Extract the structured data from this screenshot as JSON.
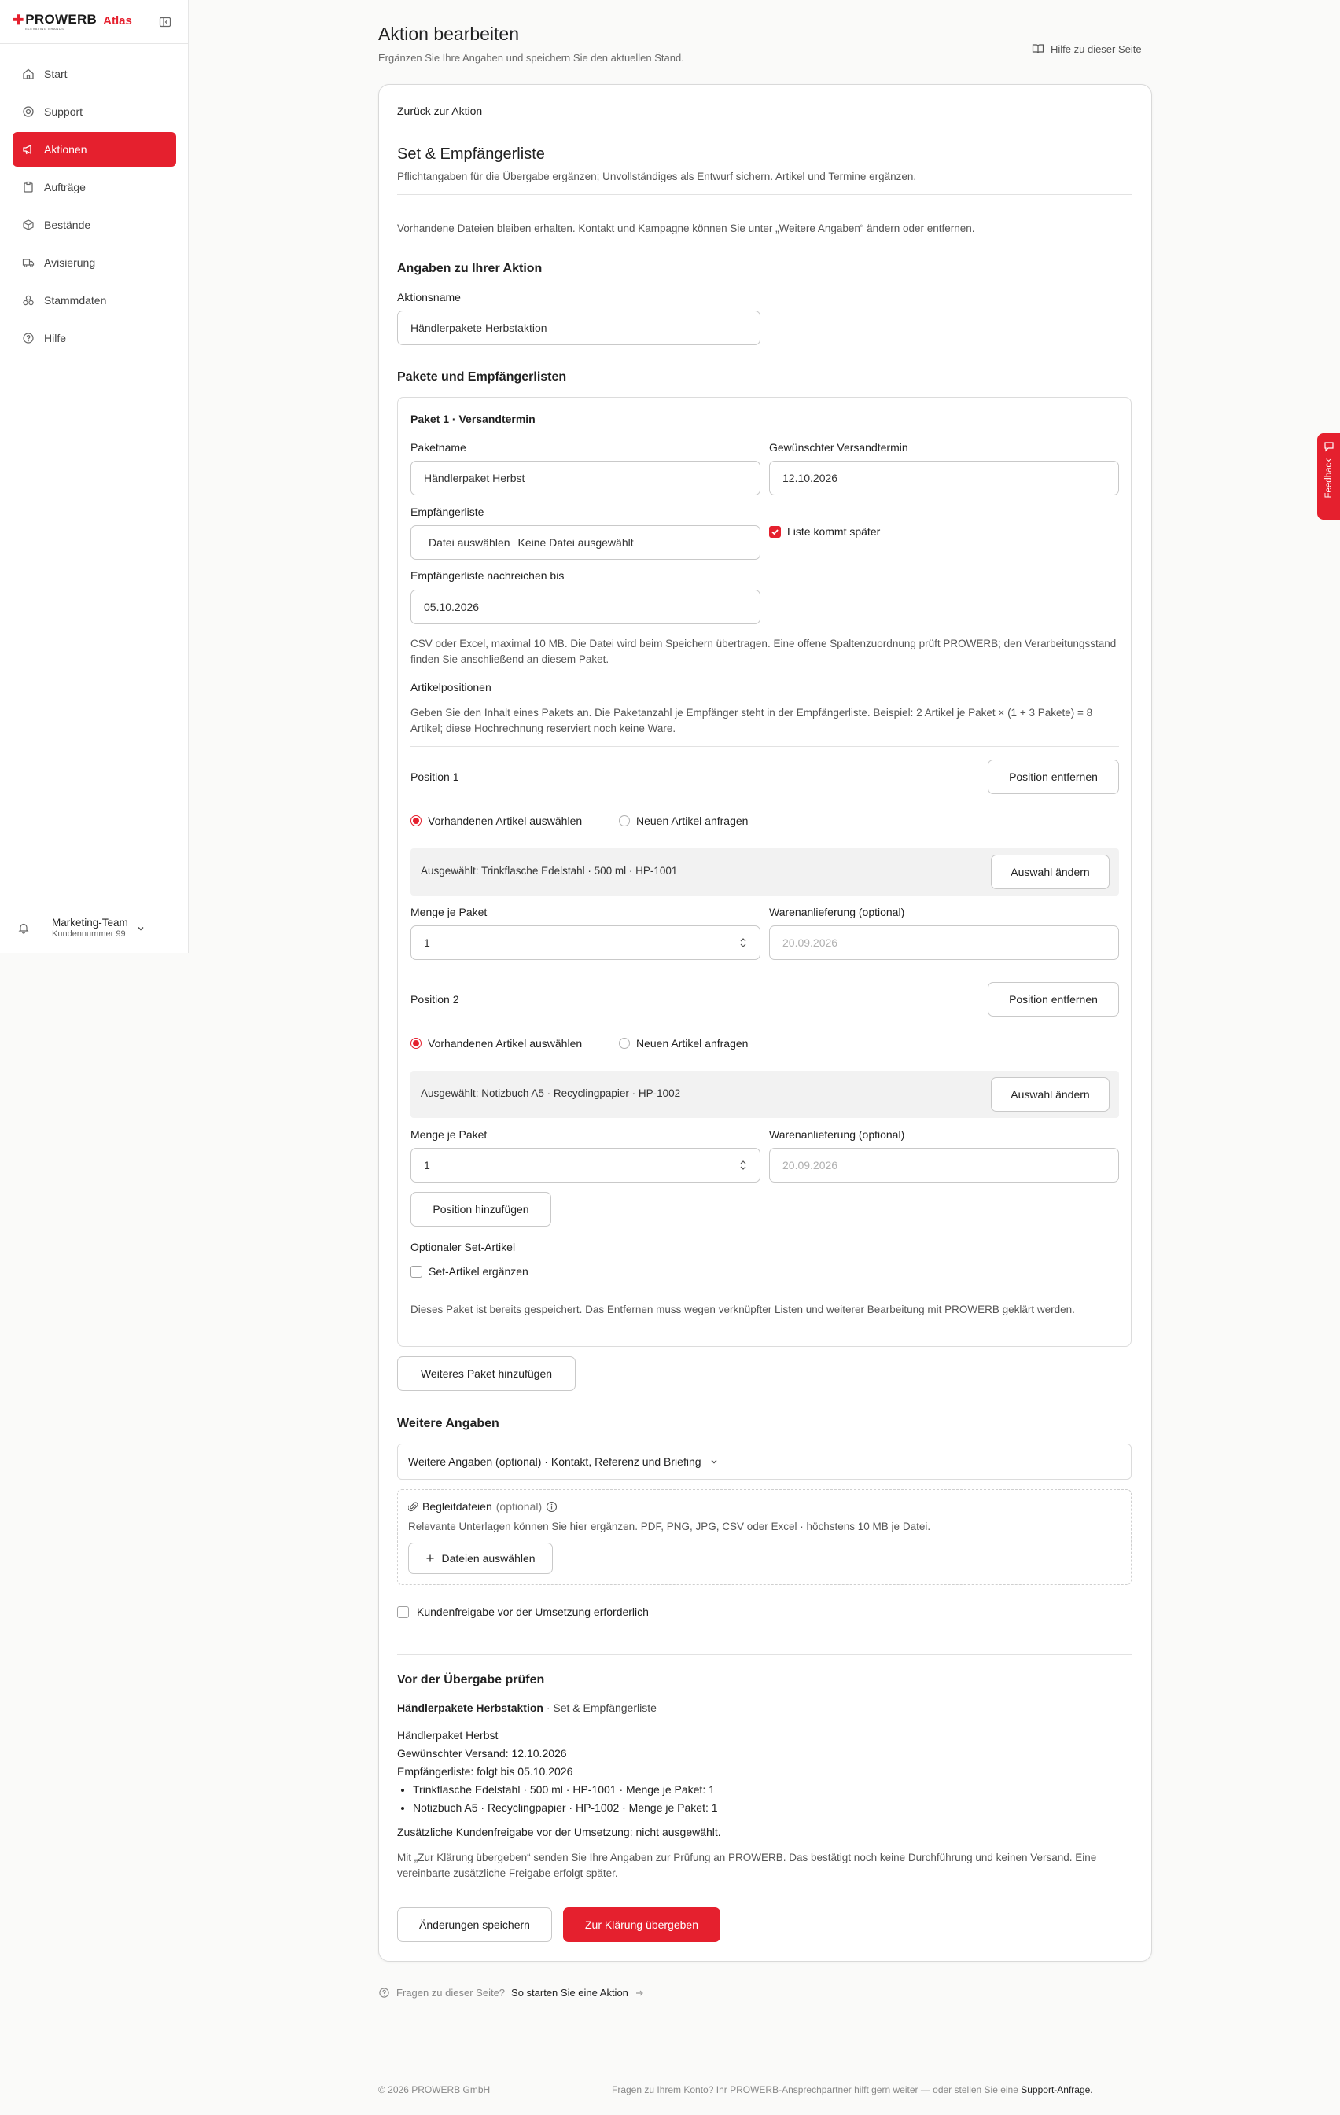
{
  "brand": {
    "logo": "PROWERB",
    "tagline": "ELEVATING BRANDS",
    "product": "Atlas"
  },
  "sidebar": {
    "items": [
      {
        "label": "Start",
        "icon": "home-icon"
      },
      {
        "label": "Support",
        "icon": "support-icon"
      },
      {
        "label": "Aktionen",
        "icon": "megaphone-icon",
        "active": true
      },
      {
        "label": "Aufträge",
        "icon": "clipboard-icon"
      },
      {
        "label": "Bestände",
        "icon": "box-icon"
      },
      {
        "label": "Avisierung",
        "icon": "truck-icon"
      },
      {
        "label": "Stammdaten",
        "icon": "database-icon"
      },
      {
        "label": "Hilfe",
        "icon": "help-icon"
      }
    ],
    "account": {
      "name": "Marketing-Team",
      "customer": "Kundennummer 99"
    }
  },
  "header": {
    "title": "Aktion bearbeiten",
    "subtitle": "Ergänzen Sie Ihre Angaben und speichern Sie den aktuellen Stand.",
    "help_link": "Hilfe zu dieser Seite"
  },
  "card": {
    "back_link": "Zurück zur Aktion",
    "heading": "Set & Empfängerliste",
    "intro": "Pflichtangaben für die Übergabe ergänzen; Unvollständiges als Entwurf sichern. Artikel und Termine ergänzen.",
    "notice": "Vorhandene Dateien bleiben erhalten. Kontakt und Kampagne können Sie unter „Weitere Angaben“ ändern oder entfernen.",
    "action_section": "Angaben zu Ihrer Aktion",
    "action_name_label": "Aktionsname",
    "action_name_value": "Händlerpakete Herbstaktion",
    "packages_section": "Pakete und Empfängerlisten"
  },
  "package": {
    "title": "Paket 1 · Versandtermin",
    "name_label": "Paketname",
    "name_value": "Händlerpaket Herbst",
    "date_label": "Gewünschter Versandtermin",
    "date_value": "12.10.2026",
    "recipients_label": "Empfängerliste",
    "file_button": "Datei auswählen",
    "file_status": "Keine Datei ausgewählt",
    "later_label": "Liste kommt später",
    "later_checked": true,
    "deadline_label": "Empfängerliste nachreichen bis",
    "deadline_value": "05.10.2026",
    "file_hint": "CSV oder Excel, maximal 10 MB. Die Datei wird beim Speichern übertragen. Eine offene Spaltenzuordnung prüft PROWERB; den Verarbeitungsstand finden Sie anschließend an diesem Paket.",
    "items_label": "Artikelpositionen",
    "items_hint": "Geben Sie den Inhalt eines Pakets an. Die Paketanzahl je Empfänger steht in der Empfängerliste. Beispiel: 2 Artikel je Paket × (1 + 3 Pakete) = 8 Artikel; diese Hochrechnung reserviert noch keine Ware.",
    "positions": [
      {
        "title": "Position 1",
        "remove": "Position entfernen",
        "opt_existing": "Vorhandenen Artikel auswählen",
        "opt_new": "Neuen Artikel anfragen",
        "selected": "Ausgewählt: Trinkflasche Edelstahl · 500 ml · HP-1001",
        "change": "Auswahl ändern",
        "qty_label": "Menge je Paket",
        "qty_value": "1",
        "delivery_label": "Warenanlieferung (optional)",
        "delivery_placeholder": "20.09.2026"
      },
      {
        "title": "Position 2",
        "remove": "Position entfernen",
        "opt_existing": "Vorhandenen Artikel auswählen",
        "opt_new": "Neuen Artikel anfragen",
        "selected": "Ausgewählt: Notizbuch A5 · Recyclingpapier · HP-1002",
        "change": "Auswahl ändern",
        "qty_label": "Menge je Paket",
        "qty_value": "1",
        "delivery_label": "Warenanlieferung (optional)",
        "delivery_placeholder": "20.09.2026"
      }
    ],
    "add_position": "Position hinzufügen",
    "set_label": "Optionaler Set-Artikel",
    "set_checkbox": "Set-Artikel ergänzen",
    "saved_hint": "Dieses Paket ist bereits gespeichert. Das Entfernen muss wegen verknüpfter Listen und weiterer Bearbeitung mit PROWERB geklärt werden."
  },
  "add_package": "Weiteres Paket hinzufügen",
  "further": {
    "section": "Weitere Angaben",
    "dropdown": "Weitere Angaben (optional) · Kontakt, Referenz und Briefing",
    "attach_title": "Begleitdateien",
    "attach_optional": "(optional)",
    "attach_hint": "Relevante Unterlagen können Sie hier ergänzen. PDF, PNG, JPG, CSV oder Excel · höchstens 10 MB je Datei.",
    "attach_button": "Dateien auswählen",
    "approval_label": "Kundenfreigabe vor der Umsetzung erforderlich"
  },
  "review": {
    "section": "Vor der Übergabe prüfen",
    "action_name": "Händlerpakete Herbstaktion",
    "action_type": "· Set & Empfängerliste",
    "package_name": "Händlerpaket Herbst",
    "shipping": "Gewünschter Versand: 12.10.2026",
    "recipients": "Empfängerliste: folgt bis 05.10.2026",
    "items": [
      "Trinkflasche Edelstahl · 500 ml · HP-1001 · Menge je Paket: 1",
      "Notizbuch A5 · Recyclingpapier · HP-1002 · Menge je Paket: 1"
    ],
    "approval": "Zusätzliche Kundenfreigabe vor der Umsetzung: nicht ausgewählt.",
    "info": "Mit „Zur Klärung übergeben“ senden Sie Ihre Angaben zur Prüfung an PROWERB. Das bestätigt noch keine Durchführung und keinen Versand. Eine vereinbarte zusätzliche Freigabe erfolgt später.",
    "save": "Änderungen speichern",
    "submit": "Zur Klärung übergeben"
  },
  "help_footer": {
    "question": "Fragen zu dieser Seite?",
    "link": "So starten Sie eine Aktion"
  },
  "feedback_tab": "Feedback",
  "footer": {
    "copyright": "© 2026 PROWERB GmbH",
    "text": "Fragen zu Ihrem Konto? Ihr PROWERB-Ansprechpartner hilft gern weiter — oder stellen Sie eine",
    "link": "Support-Anfrage."
  },
  "colors": {
    "accent": "#e5202e"
  }
}
